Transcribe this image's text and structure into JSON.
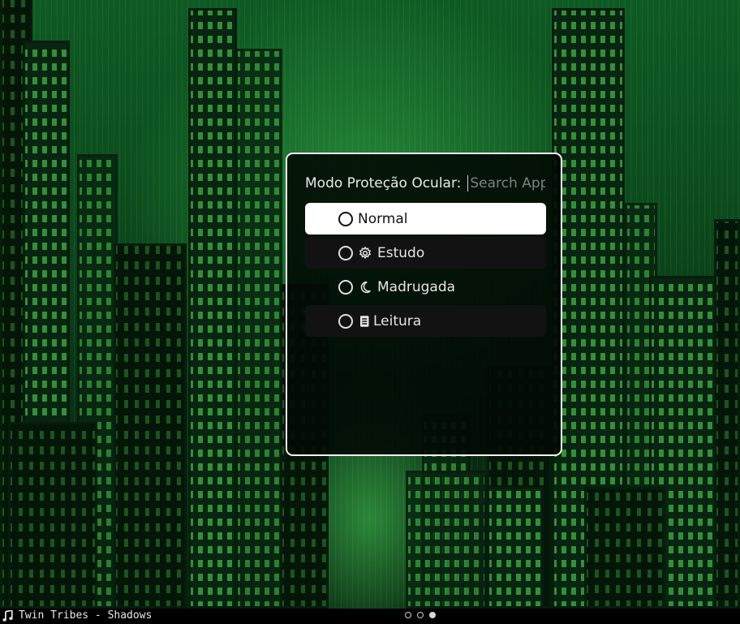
{
  "launcher": {
    "prompt": "Modo Proteção Ocular:",
    "search_placeholder": "Search Apps",
    "search_value": "",
    "items": [
      {
        "label": "Normal",
        "icon": "none",
        "state": "selected"
      },
      {
        "label": "Estudo",
        "icon": "gear-icon",
        "state": "normal"
      },
      {
        "label": "Madrugada",
        "icon": "moon-icon",
        "state": "normal"
      },
      {
        "label": "Leitura",
        "icon": "book-icon",
        "state": "normal"
      }
    ]
  },
  "statusbar": {
    "now_playing_icon": "music-note-icon",
    "now_playing": "Twin Tribes - Shadows",
    "workspaces": [
      {
        "index": 1,
        "active": false
      },
      {
        "index": 2,
        "active": false
      },
      {
        "index": 3,
        "active": true
      }
    ]
  },
  "colors": {
    "window_border": "#f2f2f2",
    "selected_item_bg": "#ffffff",
    "alt_item_bg": "#121212",
    "wallpaper_green": "#0f5a24"
  }
}
